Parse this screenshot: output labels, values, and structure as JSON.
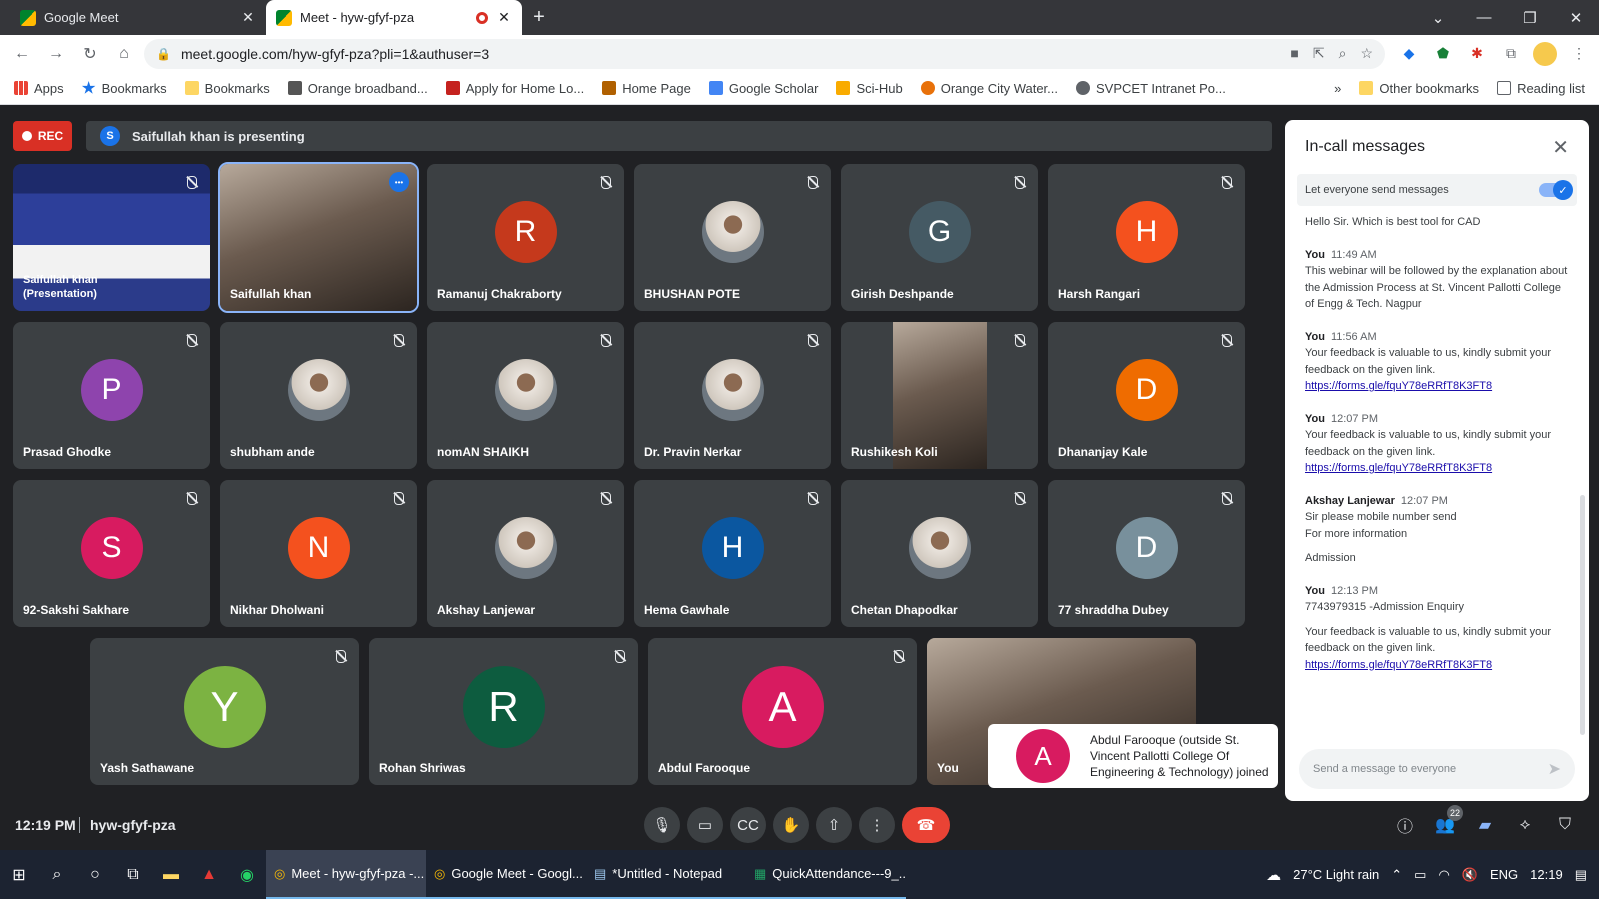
{
  "browser": {
    "tabs": [
      {
        "label": "Google Meet"
      },
      {
        "label": "Meet - hyw-gfyf-pza"
      }
    ],
    "url": "meet.google.com/hyw-gfyf-pza?pli=1&authuser=3",
    "bookmarks": [
      "Apps",
      "Bookmarks",
      "Bookmarks",
      "Orange broadband...",
      "Apply for Home Lo...",
      "Home Page",
      "Google Scholar",
      "Sci-Hub",
      "Orange City Water...",
      "SVPCET Intranet Po..."
    ],
    "bookmarks_more": "»",
    "other_bookmarks": "Other bookmarks",
    "reading_list": "Reading list"
  },
  "meet": {
    "rec": "REC",
    "presenter_initial": "S",
    "presenting": "Saifullah khan is presenting",
    "participants": [
      {
        "name": "Saifullah khan (Presentation)",
        "kind": "screen"
      },
      {
        "name": "Saifullah khan",
        "kind": "video"
      },
      {
        "name": "Ramanuj Chakraborty",
        "initial": "R",
        "color": "#c5391c"
      },
      {
        "name": "BHUSHAN POTE",
        "kind": "photo"
      },
      {
        "name": "Girish Deshpande",
        "initial": "G",
        "color": "#455a64"
      },
      {
        "name": "Harsh Rangari",
        "initial": "H",
        "color": "#f4511e"
      },
      {
        "name": "Prasad Ghodke",
        "initial": "P",
        "color": "#8e44ad"
      },
      {
        "name": "shubham ande",
        "kind": "photo"
      },
      {
        "name": "nomAN SHAIKH",
        "kind": "photo"
      },
      {
        "name": "Dr. Pravin Nerkar",
        "kind": "photo"
      },
      {
        "name": "Rushikesh Koli",
        "kind": "video"
      },
      {
        "name": "Dhananjay Kale",
        "initial": "D",
        "color": "#ef6c00"
      },
      {
        "name": "92-Sakshi Sakhare",
        "initial": "S",
        "color": "#d81b60"
      },
      {
        "name": "Nikhar Dholwani",
        "initial": "N",
        "color": "#f4511e"
      },
      {
        "name": "Akshay Lanjewar",
        "kind": "photo"
      },
      {
        "name": "Hema Gawhale",
        "initial": "H",
        "color": "#0b57a0"
      },
      {
        "name": "Chetan Dhapodkar",
        "kind": "photo"
      },
      {
        "name": "77 shraddha Dubey",
        "initial": "D",
        "color": "#78909c"
      },
      {
        "name": "Yash Sathawane",
        "initial": "Y",
        "color": "#7cb342"
      },
      {
        "name": "Rohan Shriwas",
        "initial": "R",
        "color": "#0d5c3f"
      },
      {
        "name": "Abdul Farooque",
        "initial": "A",
        "color": "#d81b60"
      },
      {
        "name": "You",
        "kind": "video"
      }
    ],
    "toast": {
      "initial": "A",
      "text": "Abdul Farooque (outside St. Vincent Pallotti College Of Engineering & Technology) joined"
    },
    "clock": "12:19 PM",
    "meeting_code": "hyw-gfyf-pza",
    "people_count": "22"
  },
  "chat": {
    "title": "In-call messages",
    "toggle_label": "Let everyone send messages",
    "first_line": "Hello Sir. Which is best tool for CAD",
    "messages": [
      {
        "sender": "You",
        "time": "11:49 AM",
        "lines": [
          "This webinar will be followed by the explanation about the Admission Process at St. Vincent Pallotti College of Engg & Tech. Nagpur"
        ],
        "link": ""
      },
      {
        "sender": "You",
        "time": "11:56 AM",
        "lines": [
          "Your feedback is valuable to us, kindly submit your feedback on the given link."
        ],
        "link": "https://forms.gle/fquY78eRRfT8K3FT8"
      },
      {
        "sender": "You",
        "time": "12:07 PM",
        "lines": [
          "Your feedback is valuable to us, kindly submit your feedback on the given link."
        ],
        "link": "https://forms.gle/fquY78eRRfT8K3FT8"
      },
      {
        "sender": "Akshay Lanjewar",
        "time": "12:07 PM",
        "lines": [
          "Sir please mobile number send",
          "For more information",
          "Admission"
        ],
        "link": ""
      },
      {
        "sender": "You",
        "time": "12:13 PM",
        "lines": [
          "7743979315 -Admission Enquiry",
          "Your feedback is valuable to us, kindly submit your feedback on the given link."
        ],
        "link": "https://forms.gle/fquY78eRRfT8K3FT8"
      }
    ],
    "input_placeholder": "Send a message to everyone"
  },
  "taskbar": {
    "apps": [
      "Meet - hyw-gfyf-pza -...",
      "Google Meet - Googl...",
      "*Untitled - Notepad",
      "QuickAttendance---9_..."
    ],
    "weather": "27°C  Light rain",
    "lang": "ENG",
    "time": "12:19"
  }
}
